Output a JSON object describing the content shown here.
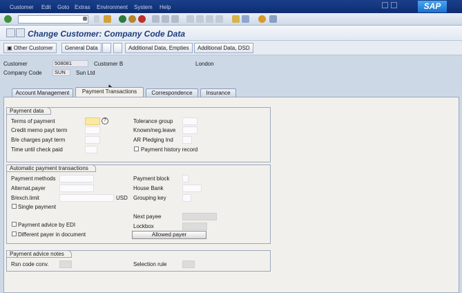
{
  "menu": [
    "Customer",
    "Edit",
    "Goto",
    "Extras",
    "Environment",
    "System",
    "Help"
  ],
  "brand": "SAP",
  "title": "Change Customer: Company Code Data",
  "app_toolbar": {
    "other_customer": "Other Customer",
    "general_data": "General Data",
    "additional_empties": "Additional Data, Empties",
    "additional_dsd": "Additional Data, DSD"
  },
  "header": {
    "customer_label": "Customer",
    "customer_number": "508081",
    "customer_name": "Customer B",
    "city": "London",
    "company_code_label": "Company Code",
    "company_code": "SUN",
    "company_name": "Sun Ltd"
  },
  "tabs": [
    {
      "label": "Account Management",
      "active": false
    },
    {
      "label": "Payment Transactions",
      "active": true
    },
    {
      "label": "Correspondence",
      "active": false
    },
    {
      "label": "Insurance",
      "active": false
    }
  ],
  "payment_data": {
    "title": "Payment data",
    "terms_of_payment": "Terms of payment",
    "credit_memo": "Credit memo payt term",
    "ble_charges": "B/e charges payt term",
    "time_until_check": "Time until check paid",
    "tolerance_group": "Tolerance group",
    "known_neg_leave": "Known/neg.leave",
    "ar_pledging": "AR Pledging Ind",
    "payment_history": "Payment history record"
  },
  "automatic_payment": {
    "title": "Automatic payment transactions",
    "payment_methods": "Payment methods",
    "alternat_payer": "Alternat.payer",
    "bexch_limit": "B/exch.limit",
    "currency": "USD",
    "single_payment": "Single payment",
    "payment_advice_edi": "Payment advice by EDI",
    "different_payer": "Different payer in document",
    "payment_block": "Payment block",
    "house_bank": "House Bank",
    "grouping_key": "Grouping key",
    "next_payee": "Next payee",
    "lockbox": "Lockbox",
    "allowed_payer": "Allowed payer"
  },
  "payment_advice_notes": {
    "title": "Payment advice notes",
    "rsn_code_conv": "Rsn code conv.",
    "selection_rule": "Selection rule"
  },
  "colors": {
    "menubar": "#0d2d73",
    "title_text": "#1e3c7e",
    "panel": "#f1f0ec",
    "required_field": "#fbe9a3"
  }
}
